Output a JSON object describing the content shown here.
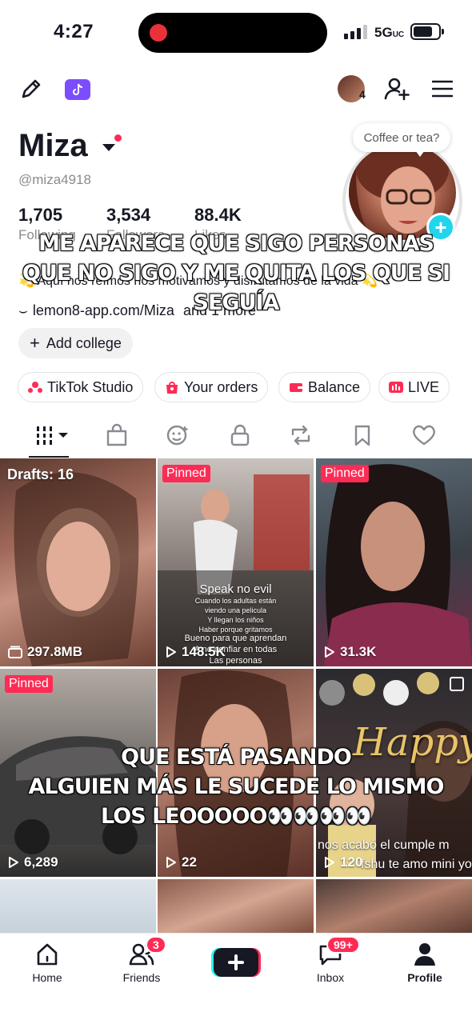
{
  "status_bar": {
    "time": "4:27",
    "network": "5G",
    "network_suffix": "UC",
    "battery_level": 0.75
  },
  "top_bar": {
    "edit_icon": "pencil-icon",
    "studio_icon": "tiktok-studio-icon",
    "avatar_count": "4",
    "add_friend_icon": "add-user-icon",
    "menu_icon": "hamburger-menu-icon"
  },
  "profile": {
    "name": "Miza",
    "handle": "@miza4918",
    "bubble": "Coffee or tea?",
    "stats": [
      {
        "value": "1,705",
        "label": "Following"
      },
      {
        "value": "3,534",
        "label": "Followers"
      },
      {
        "value": "88.4K",
        "label": "Likes"
      }
    ],
    "bio": "💫 Aquí nos reímos nos motivamos y disfrutamos de la vida 💫",
    "link": "lemon8-app.com/Miza",
    "link_suffix": "and 1 more",
    "add_college": "Add college"
  },
  "shortcuts": [
    {
      "label": "TikTok Studio",
      "color": "#fe2c55"
    },
    {
      "label": "Your orders",
      "color": "#fe2c55"
    },
    {
      "label": "Balance",
      "color": "#fe2c55"
    },
    {
      "label": "LIVE",
      "color": "#fe2c55"
    }
  ],
  "tabs": [
    "videos-grid-icon",
    "shop-bag-icon",
    "reposts-face-icon",
    "lock-icon",
    "repost-icon",
    "bookmark-icon",
    "heart-icon"
  ],
  "grid": {
    "tiles": [
      {
        "badge": "",
        "top_label": "Drafts: 16",
        "count": "297.8MB",
        "count_icon": "drafts-icon"
      },
      {
        "badge": "Pinned",
        "count": "148.5K",
        "title": "Speak no evil",
        "lines": [
          "Cuando los adultas están",
          "viendo una pelicula",
          "Y llegan los niños",
          "Haber porque gritamos"
        ],
        "lines2": [
          "Bueno para que aprendan",
          "A no confiar en todas",
          "Las personas"
        ]
      },
      {
        "badge": "Pinned",
        "count": "31.3K"
      },
      {
        "badge": "Pinned",
        "count": "6,289"
      },
      {
        "badge": "",
        "count": "22"
      },
      {
        "badge": "",
        "count": "120",
        "happy": "Happy",
        "caption1": "nos acabó el cumple m",
        "caption2": "fshu te amo mini yo"
      }
    ]
  },
  "overlays": {
    "top": [
      "ME APARECE QUE SIGO PERSONAS",
      "QUE NO SIGO Y ME QUITA LOS QUE SI",
      "SEGUÍA"
    ],
    "middle": [
      "QUE ESTÁ PASANDO",
      "ALGUIEN MÁS LE SUCEDE LO MISMO",
      "LOS LEOOOOO👀👀👀👀"
    ]
  },
  "bottom_nav": [
    {
      "label": "Home",
      "badge": ""
    },
    {
      "label": "Friends",
      "badge": "3"
    },
    {
      "label": "",
      "badge": ""
    },
    {
      "label": "Inbox",
      "badge": "99+"
    },
    {
      "label": "Profile",
      "badge": ""
    }
  ]
}
